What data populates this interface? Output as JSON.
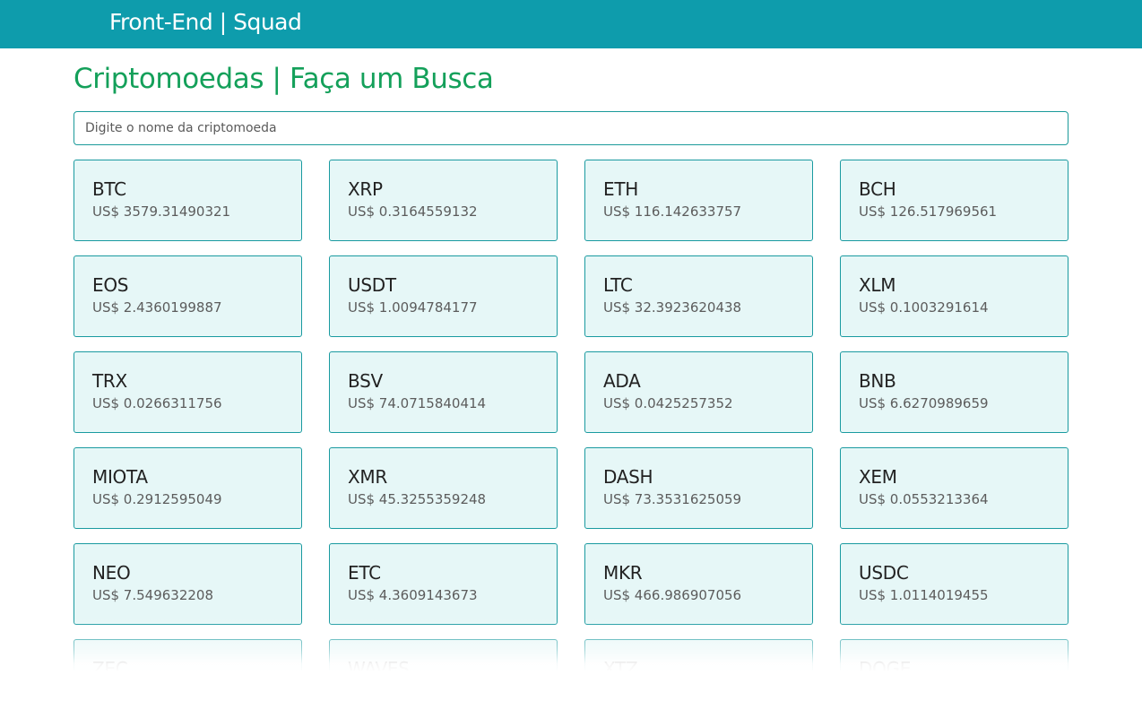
{
  "header": {
    "brand": "Front-End | Squad"
  },
  "main": {
    "title": "Criptomoedas | Faça um Busca",
    "search": {
      "placeholder": "Digite o nome da criptomoeda",
      "value": ""
    },
    "currency_prefix": "US$",
    "coins": [
      {
        "symbol": "BTC",
        "price": "US$ 3579.31490321"
      },
      {
        "symbol": "XRP",
        "price": "US$ 0.3164559132"
      },
      {
        "symbol": "ETH",
        "price": "US$ 116.142633757"
      },
      {
        "symbol": "BCH",
        "price": "US$ 126.517969561"
      },
      {
        "symbol": "EOS",
        "price": "US$ 2.4360199887"
      },
      {
        "symbol": "USDT",
        "price": "US$ 1.0094784177"
      },
      {
        "symbol": "LTC",
        "price": "US$ 32.3923620438"
      },
      {
        "symbol": "XLM",
        "price": "US$ 0.1003291614"
      },
      {
        "symbol": "TRX",
        "price": "US$ 0.0266311756"
      },
      {
        "symbol": "BSV",
        "price": "US$ 74.0715840414"
      },
      {
        "symbol": "ADA",
        "price": "US$ 0.0425257352"
      },
      {
        "symbol": "BNB",
        "price": "US$ 6.6270989659"
      },
      {
        "symbol": "MIOTA",
        "price": "US$ 0.2912595049"
      },
      {
        "symbol": "XMR",
        "price": "US$ 45.3255359248"
      },
      {
        "symbol": "DASH",
        "price": "US$ 73.3531625059"
      },
      {
        "symbol": "XEM",
        "price": "US$ 0.0553213364"
      },
      {
        "symbol": "NEO",
        "price": "US$ 7.549632208"
      },
      {
        "symbol": "ETC",
        "price": "US$ 4.3609143673"
      },
      {
        "symbol": "MKR",
        "price": "US$ 466.986907056"
      },
      {
        "symbol": "USDC",
        "price": "US$ 1.0114019455"
      },
      {
        "symbol": "ZEC",
        "price": ""
      },
      {
        "symbol": "WAVES",
        "price": ""
      },
      {
        "symbol": "XTZ",
        "price": ""
      },
      {
        "symbol": "DOGE",
        "price": ""
      }
    ]
  },
  "colors": {
    "header_bg": "#0e9cac",
    "title": "#14a05a",
    "card_bg": "#e6f7f7",
    "card_border": "#1a9aa0"
  }
}
